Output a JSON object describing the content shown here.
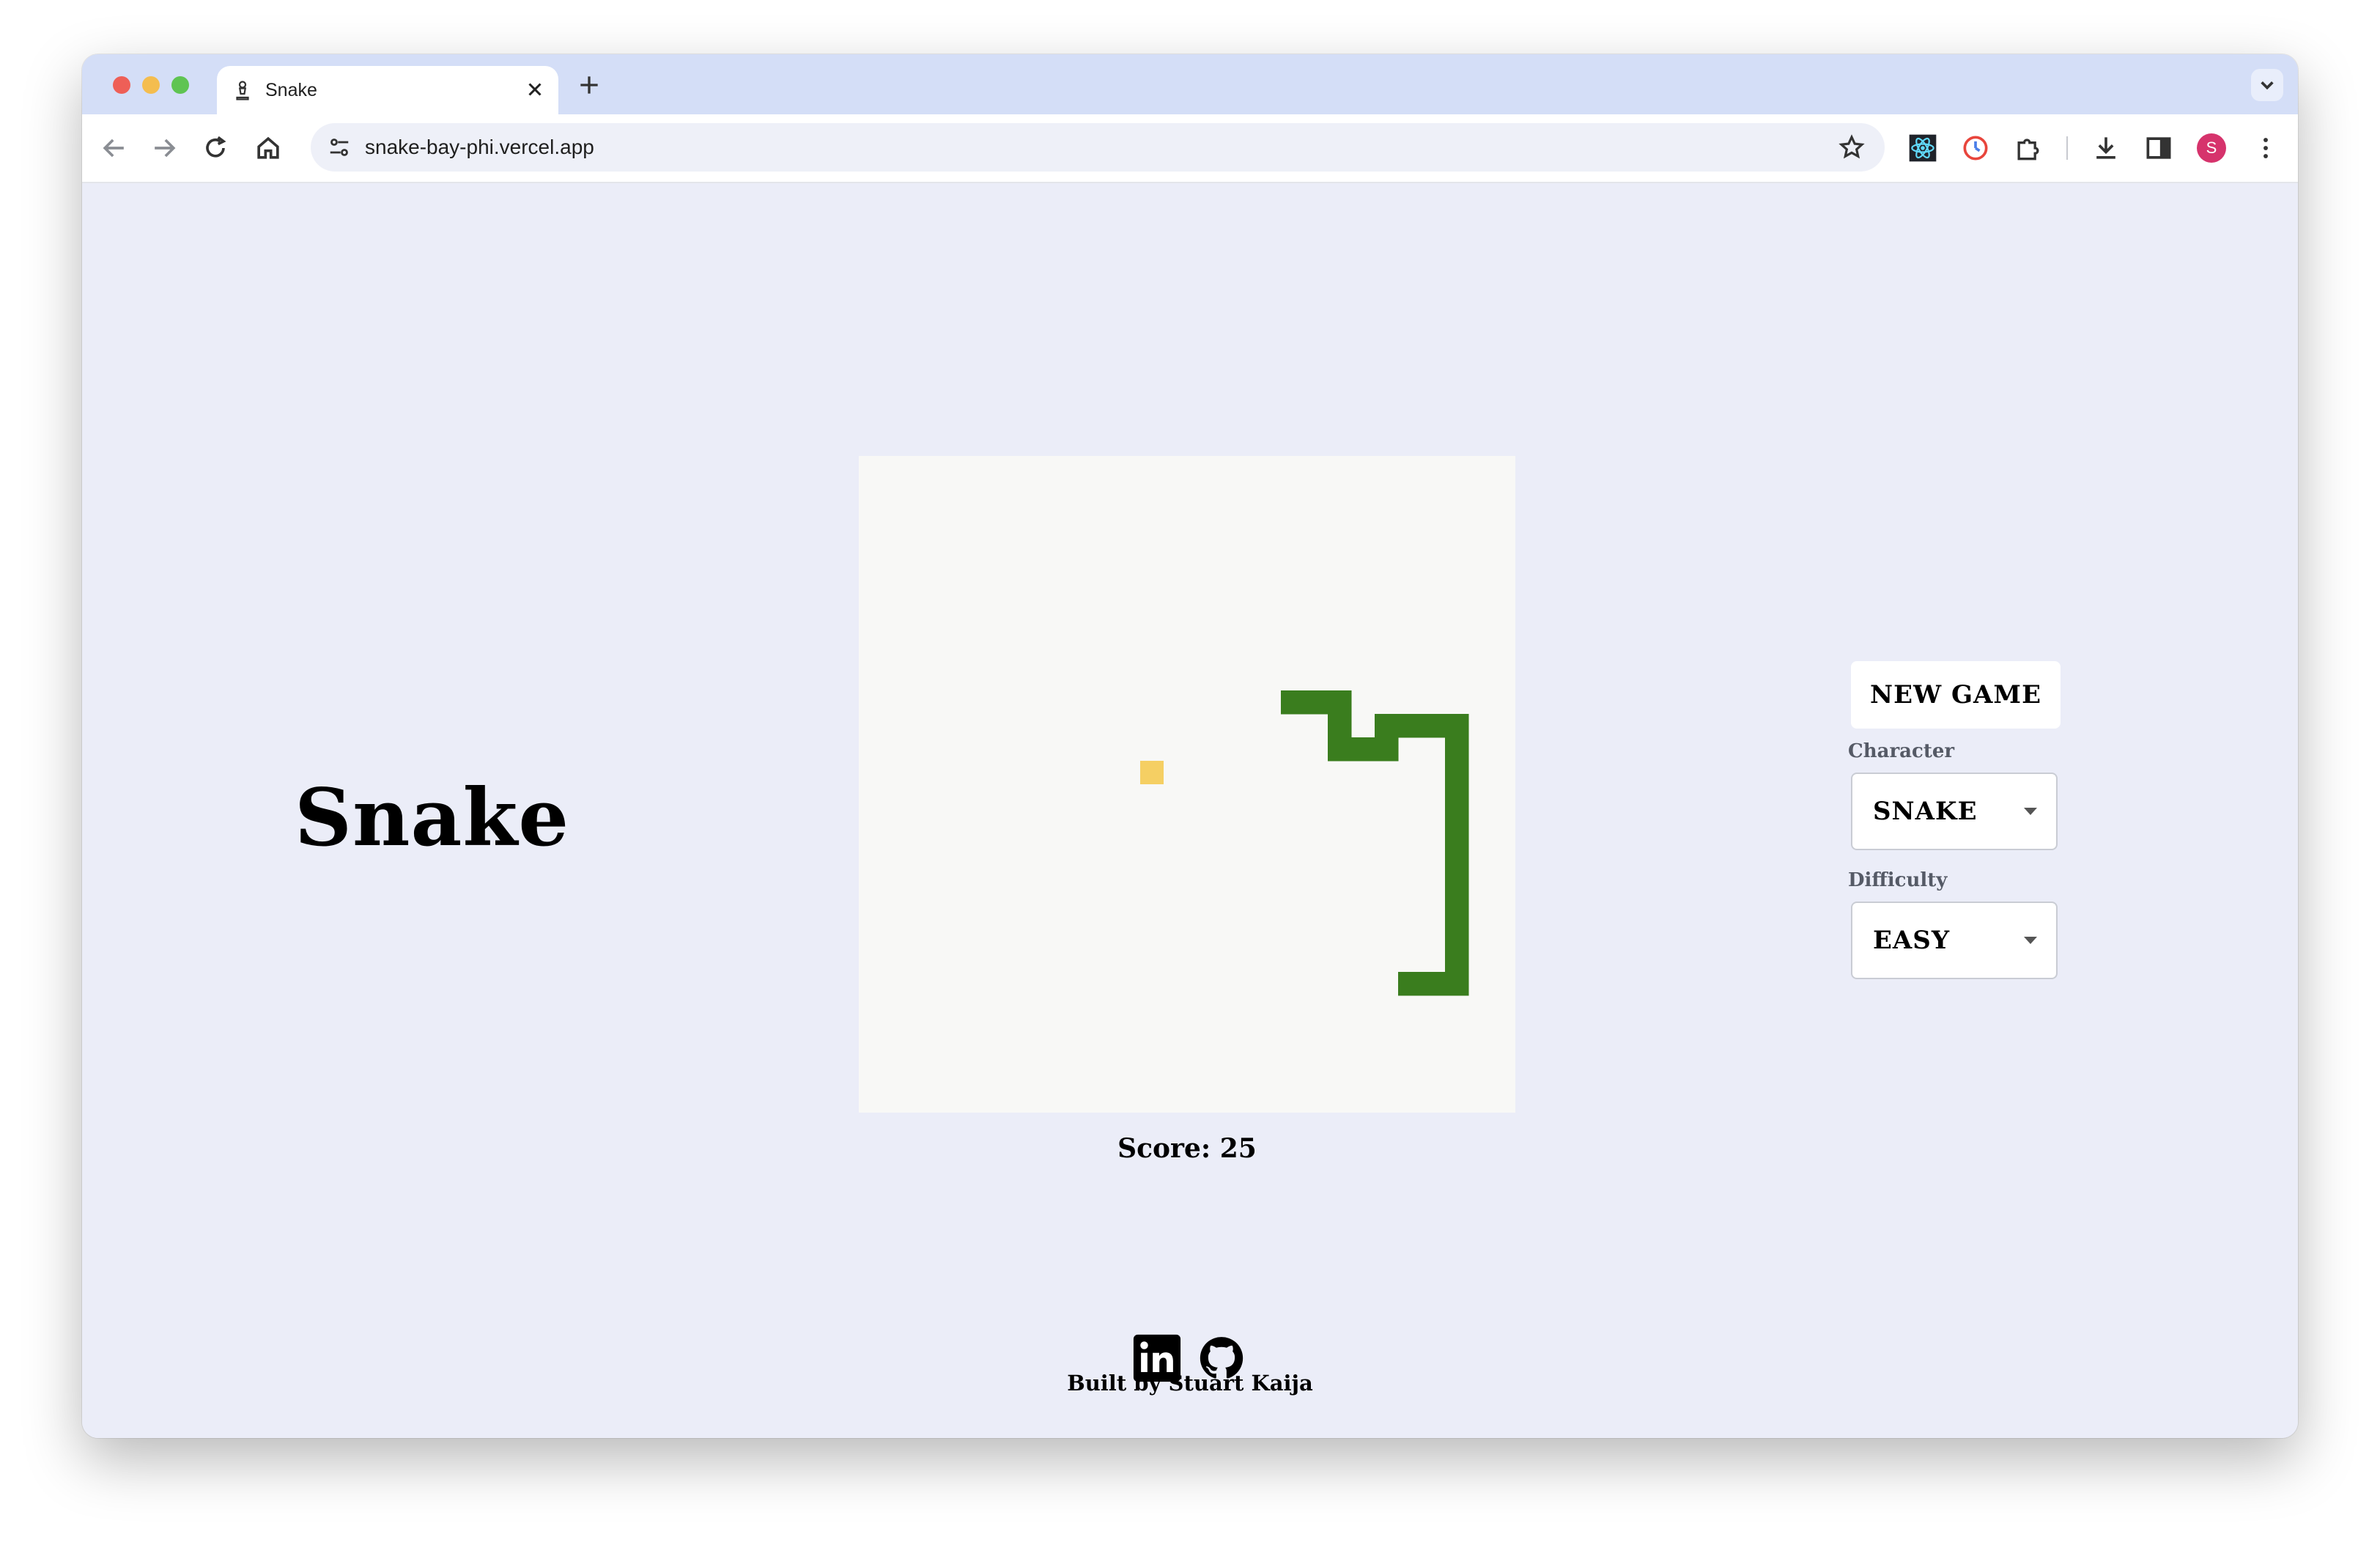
{
  "browser": {
    "tab_title": "Snake",
    "url": "snake-bay-phi.vercel.app",
    "avatar_letter": "S"
  },
  "page": {
    "title": "Snake",
    "score_label": "Score: 25",
    "new_game_label": "NEW GAME",
    "character_label": "Character",
    "character_value": "SNAKE",
    "difficulty_label": "Difficulty",
    "difficulty_value": "EASY",
    "footer_text": "Built by Stuart Kaija"
  },
  "game": {
    "grid_size": 28,
    "snake_color": "#3a7d1e",
    "food_color": "#f5cf63",
    "board_color": "#f8f8f6",
    "food_cell": [
      12,
      13
    ],
    "snake_cells": [
      [
        18,
        10
      ],
      [
        19,
        10
      ],
      [
        20,
        10
      ],
      [
        20,
        11
      ],
      [
        20,
        12
      ],
      [
        21,
        12
      ],
      [
        22,
        12
      ],
      [
        22,
        11
      ],
      [
        23,
        11
      ],
      [
        24,
        11
      ],
      [
        25,
        11
      ],
      [
        25,
        12
      ],
      [
        25,
        13
      ],
      [
        25,
        14
      ],
      [
        25,
        15
      ],
      [
        25,
        16
      ],
      [
        25,
        17
      ],
      [
        25,
        18
      ],
      [
        25,
        19
      ],
      [
        25,
        20
      ],
      [
        25,
        21
      ],
      [
        24,
        22
      ],
      [
        25,
        22
      ],
      [
        23,
        22
      ]
    ]
  },
  "icons": {
    "tab_icon": "chess-pawn-icon",
    "linkedin": "linkedin-icon",
    "github": "github-icon"
  }
}
